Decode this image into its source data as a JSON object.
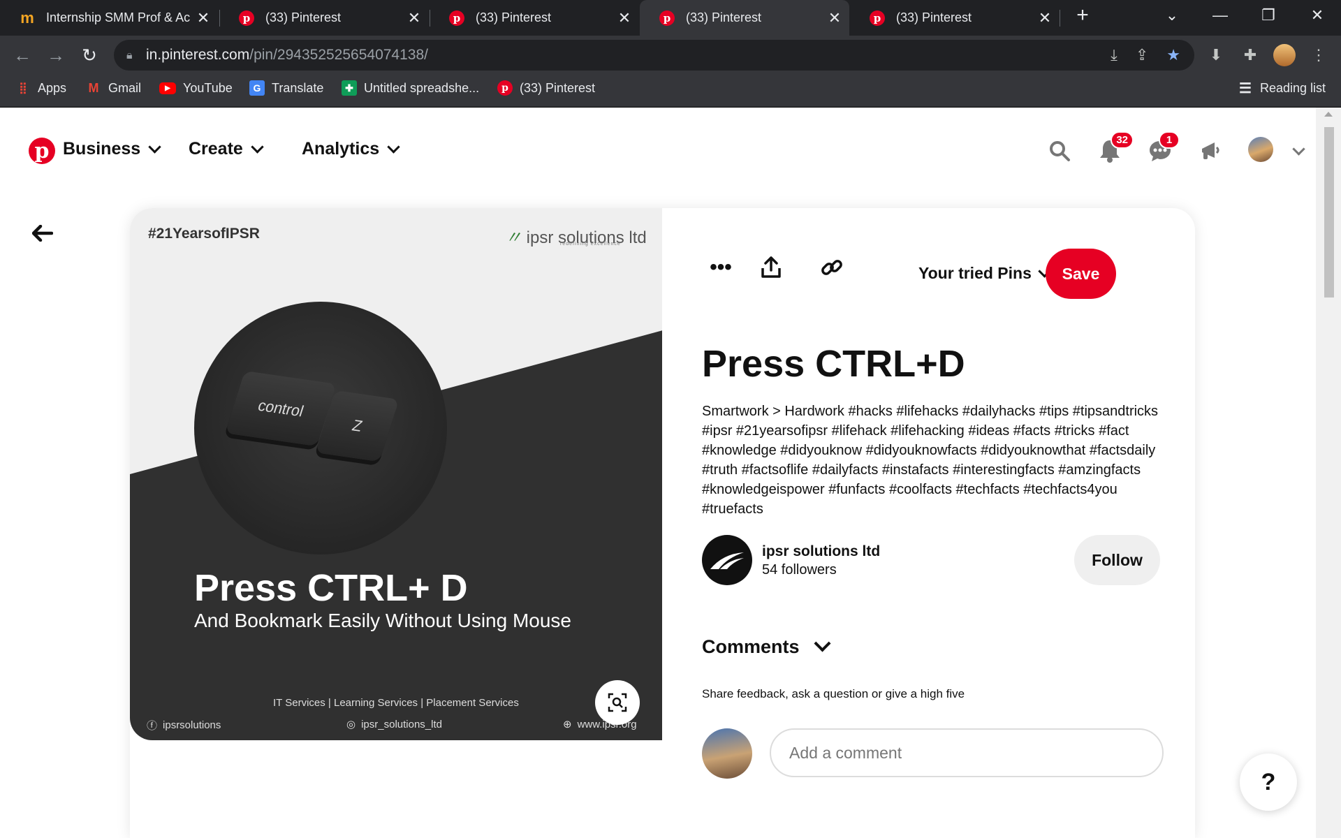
{
  "browser": {
    "tabs": [
      {
        "title": "Internship SMM Prof & Ac",
        "favicon": "m-icon",
        "active": false
      },
      {
        "title": "(33) Pinterest",
        "favicon": "pinterest-icon",
        "active": false
      },
      {
        "title": "(33) Pinterest",
        "favicon": "pinterest-icon",
        "active": false
      },
      {
        "title": "(33) Pinterest",
        "favicon": "pinterest-icon",
        "active": true
      },
      {
        "title": "(33) Pinterest",
        "favicon": "pinterest-icon",
        "active": false
      }
    ],
    "new_tab": "+",
    "url_host": "in.pinterest.com",
    "url_path": "/pin/294352525654074138/",
    "bookmarks": [
      {
        "label": "Apps",
        "icon": "apps-icon"
      },
      {
        "label": "Gmail",
        "icon": "gmail-icon"
      },
      {
        "label": "YouTube",
        "icon": "youtube-icon"
      },
      {
        "label": "Translate",
        "icon": "translate-icon"
      },
      {
        "label": "Untitled spreadshe...",
        "icon": "sheets-icon"
      },
      {
        "label": "(33) Pinterest",
        "icon": "pinterest-icon"
      }
    ],
    "reading_list": "Reading list"
  },
  "header": {
    "menus": [
      "Business",
      "Create",
      "Analytics"
    ],
    "notifications_count": "32",
    "messages_count": "1",
    "accent": "#e60023"
  },
  "pin_image": {
    "hashtag": "#21YearsofIPSR",
    "brand": "ipsr solutions ltd",
    "brand_tagline": "redefining excellence",
    "key1": "control",
    "key2": "Z",
    "headline": "Press CTRL+ D",
    "subheadline": "And Bookmark Easily Without Using Mouse",
    "services": "IT Services | Learning Services | Placement Services",
    "facebook": "ipsrsolutions",
    "instagram": "ipsr_solutions_ltd",
    "website": "www.ipsr.org"
  },
  "pin": {
    "tried_label": "Your tried Pins",
    "save_label": "Save",
    "title": "Press CTRL+D",
    "description": "Smartwork > Hardwork #hacks #lifehacks #dailyhacks #tips #tipsandtricks #ipsr #21yearsofipsr #lifehack #lifehacking #ideas #facts #tricks #fact #knowledge #didyouknow #didyouknowfacts #didyouknowthat #factsdaily #truth #factsoflife #dailyfacts #instafacts #interestingfacts #amzingfacts #knowledgeispower #funfacts #coolfacts #techfacts #techfacts4you #truefacts",
    "owner_name": "ipsr solutions ltd",
    "owner_followers": "54 followers",
    "follow_label": "Follow",
    "comments_label": "Comments",
    "feedback_prompt": "Share feedback, ask a question or give a high five",
    "comment_placeholder": "Add a comment"
  },
  "help_label": "?"
}
